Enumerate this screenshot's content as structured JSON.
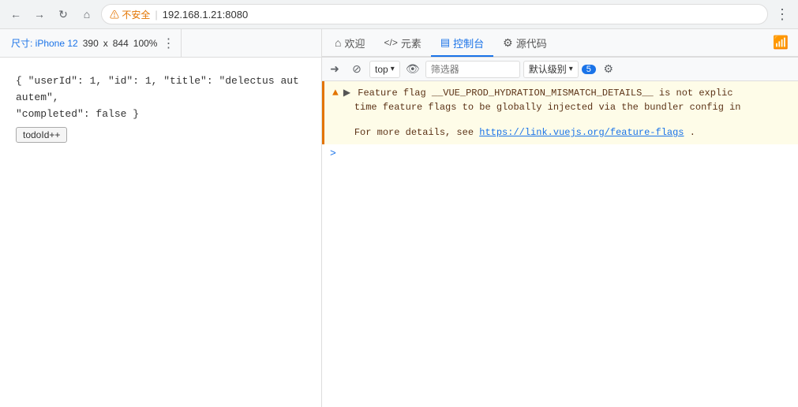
{
  "browser": {
    "back_label": "←",
    "forward_label": "→",
    "refresh_label": "↻",
    "home_label": "⌂",
    "security_warning": "⚠ 不安全",
    "address": "192.168.1.21:8080",
    "more_label": "⋮"
  },
  "device_bar": {
    "label": "尺寸: iPhone 12",
    "width": "390",
    "x_label": "x",
    "height": "844",
    "zoom": "100%",
    "more_label": "⋮"
  },
  "mobile_content": {
    "todo_text": "{ \"userId\": 1, \"id\": 1, \"title\": \"delectus aut autem\",\n\"completed\": false }",
    "button_label": "todoId++"
  },
  "devtools": {
    "tabs": [
      {
        "label": "欢迎",
        "icon": "⌂",
        "active": false
      },
      {
        "label": "元素",
        "icon": "</>",
        "active": false
      },
      {
        "label": "控制台",
        "icon": "📋",
        "active": true
      },
      {
        "label": "源代码",
        "icon": "⚙",
        "active": false
      }
    ],
    "console": {
      "clear_label": "🚫",
      "block_label": "⊘",
      "top_label": "top",
      "dropdown_label": "▾",
      "eye_label": "👁",
      "filter_placeholder": "筛选器",
      "level_label": "默认级别",
      "level_dropdown": "▾",
      "badge_count": "5",
      "gear_label": "⚙",
      "warning": {
        "icon": "▲",
        "expand_icon": "▶",
        "line1": "Feature flag __VUE_PROD_HYDRATION_MISMATCH_DETAILS__ is not explic",
        "line2": "time feature flags to be globally injected via the bundler config in",
        "line3": "For more details, see ",
        "link_text": "https://link.vuejs.org/feature-flags",
        "link_suffix": "."
      },
      "arrow_label": ">"
    }
  }
}
